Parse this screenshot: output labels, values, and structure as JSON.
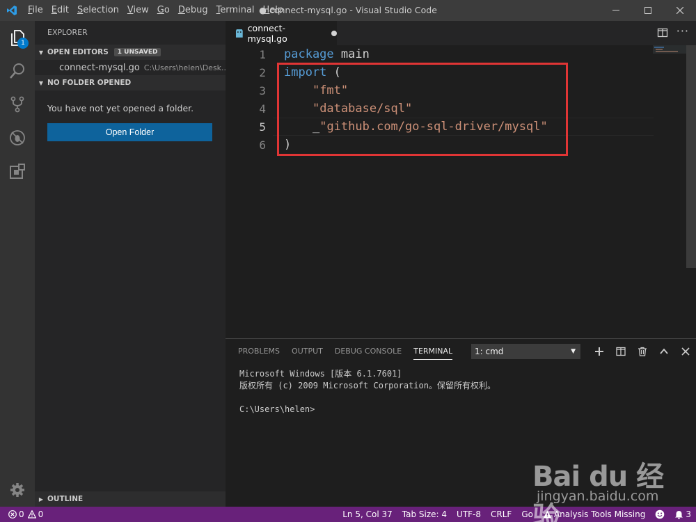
{
  "titlebar": {
    "menu": [
      "File",
      "Edit",
      "Selection",
      "View",
      "Go",
      "Debug",
      "Terminal",
      "Help"
    ],
    "title": "● connect-mysql.go - Visual Studio Code"
  },
  "activitybar": {
    "items": [
      "files-icon",
      "search-icon",
      "source-control-icon",
      "debug-icon",
      "extensions-icon"
    ],
    "explorer_badge": "1",
    "manage": "gear-icon"
  },
  "sidebar": {
    "title": "EXPLORER",
    "open_editors": {
      "label": "OPEN EDITORS",
      "badge": "1 UNSAVED",
      "file_name": "connect-mysql.go",
      "file_path": "C:\\Users\\helen\\Desk..."
    },
    "no_folder": {
      "label": "NO FOLDER OPENED",
      "message": "You have not yet opened a folder.",
      "button": "Open Folder"
    },
    "outline_label": "OUTLINE"
  },
  "editor": {
    "tab_label": "connect-mysql.go",
    "line_numbers": [
      "1",
      "2",
      "3",
      "4",
      "5",
      "6"
    ],
    "active_line": 5,
    "code": {
      "l1_kw": "package",
      "l1_rest": " main",
      "l2_kw": "import",
      "l2_rest": " (",
      "l3_str": "\"fmt\"",
      "l4_str": "\"database/sql\"",
      "l5_blank": "_",
      "l5_str": "\"github.com/go-sql-driver/mysql\"",
      "l6": ")"
    }
  },
  "panel": {
    "tabs": [
      "PROBLEMS",
      "OUTPUT",
      "DEBUG CONSOLE",
      "TERMINAL"
    ],
    "active_tab": "TERMINAL",
    "terminal_select": "1: cmd",
    "terminal_lines": [
      "Microsoft Windows [版本 6.1.7601]",
      "版权所有 (c) 2009 Microsoft Corporation。保留所有权利。",
      "",
      "C:\\Users\\helen>"
    ]
  },
  "statusbar": {
    "errors": "0",
    "warnings": "0",
    "position": "Ln 5, Col 37",
    "tab_size": "Tab Size: 4",
    "encoding": "UTF-8",
    "eol": "CRLF",
    "language": "Go",
    "analysis": "Analysis Tools Missing",
    "notifications": "3"
  },
  "watermark": {
    "logo": "Bai du 经验",
    "url": "jingyan.baidu.com"
  },
  "colors": {
    "statusbar": "#68217a",
    "accent": "#007acc",
    "highlight_box": "#e03535"
  }
}
